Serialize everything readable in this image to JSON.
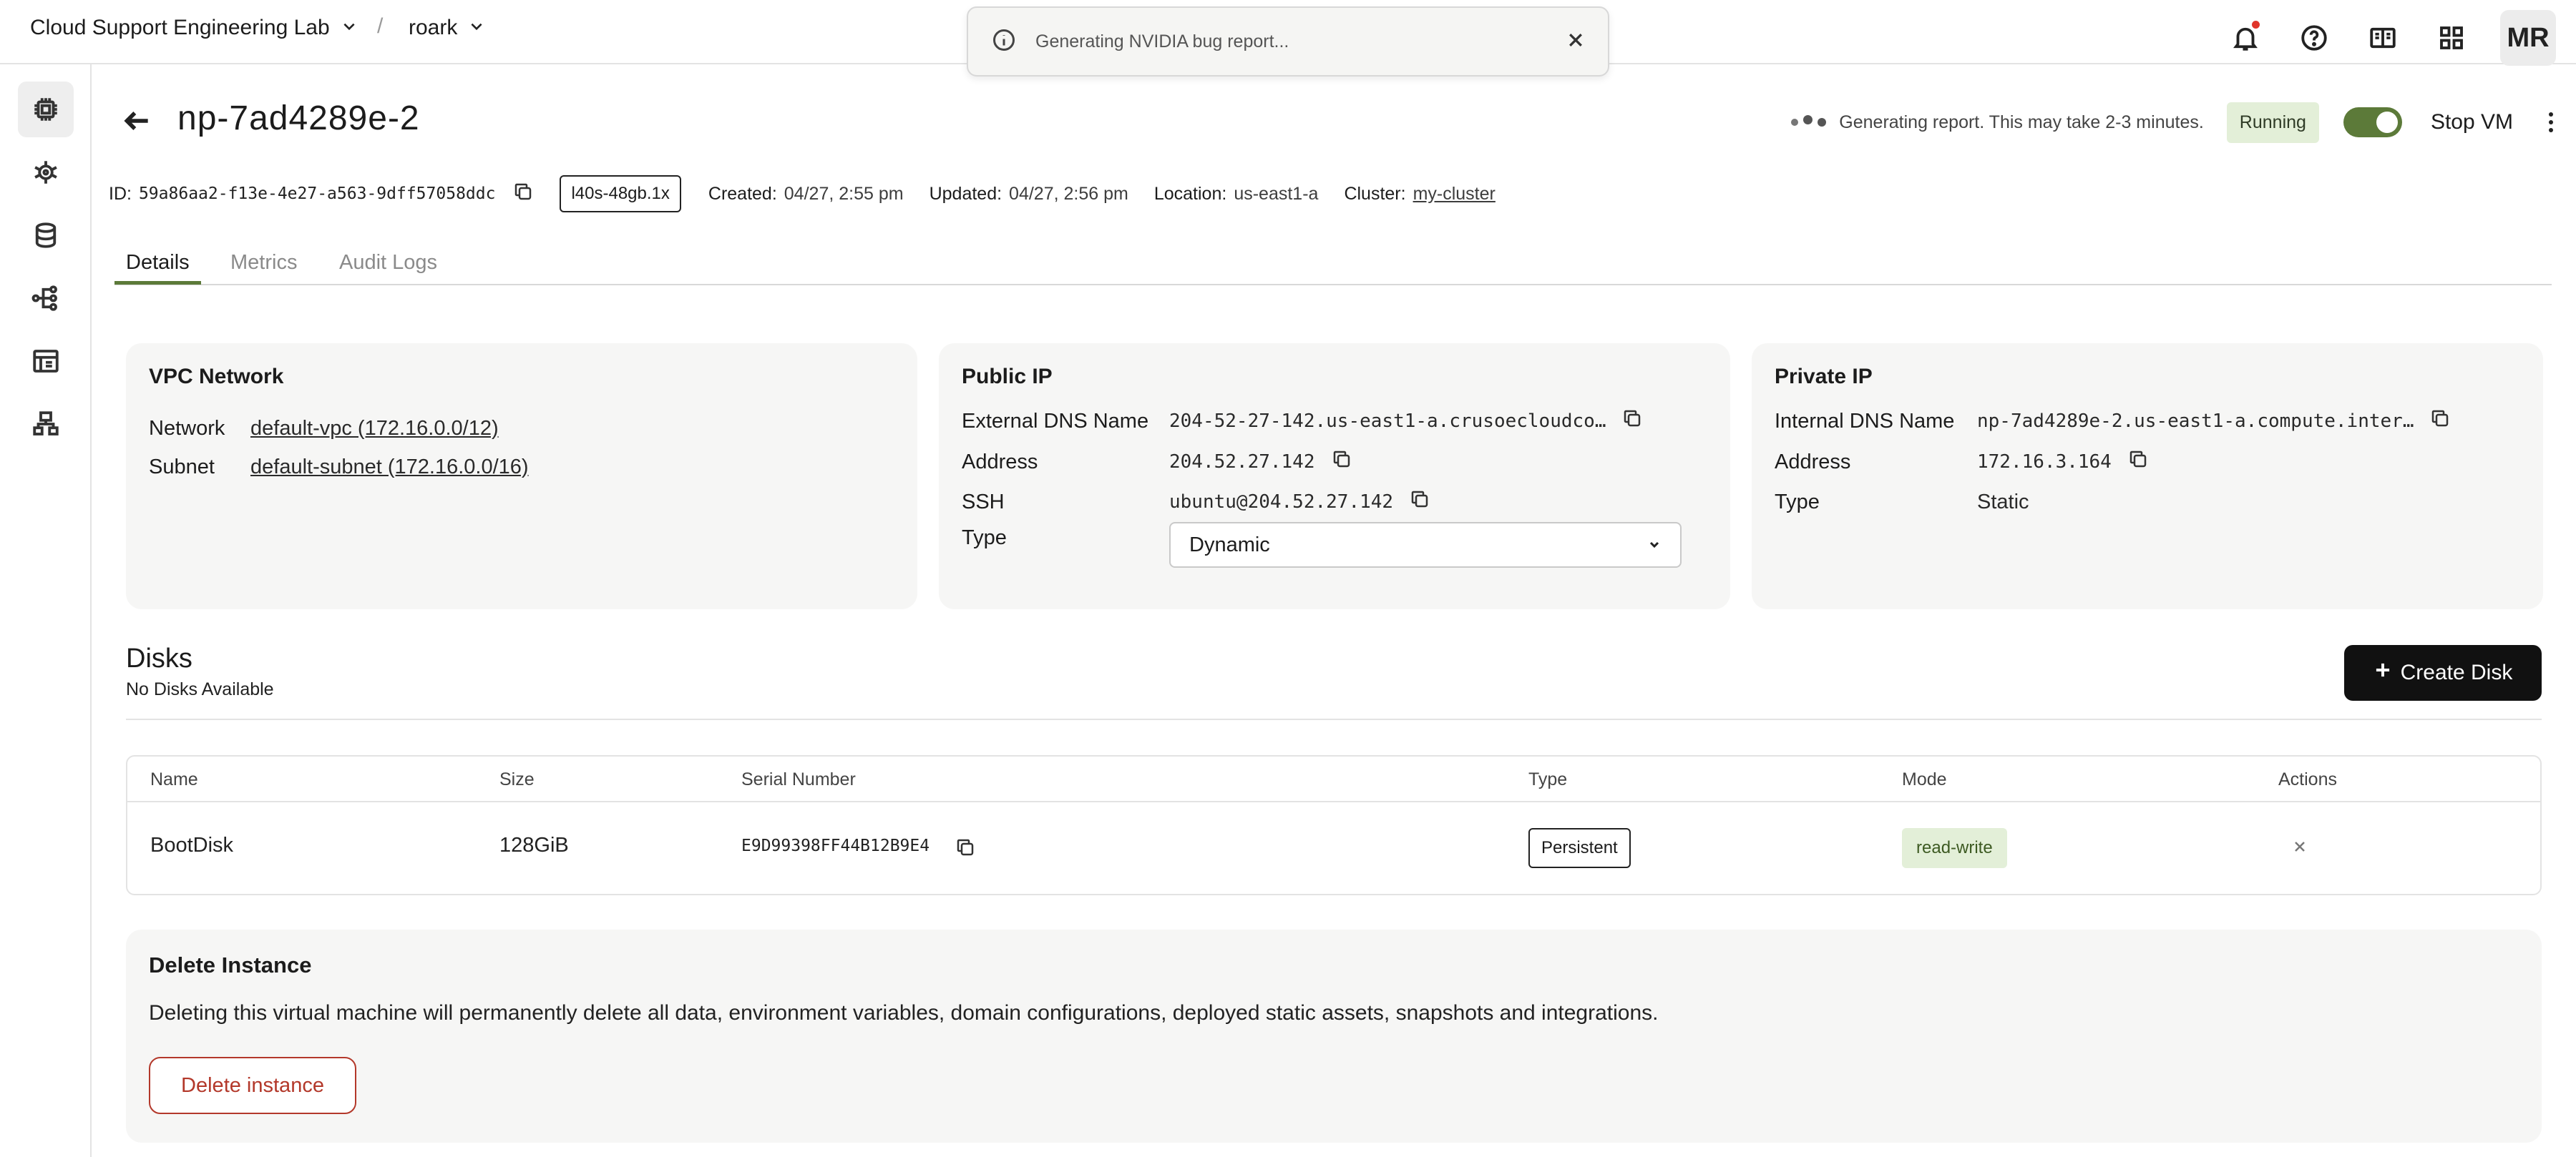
{
  "topbar": {
    "org_name": "Cloud Support Engineering Lab",
    "separator": "/",
    "project_name": "roark",
    "avatar_initials": "MR",
    "icons": [
      "bell-icon",
      "help-icon",
      "docs-icon",
      "apps-grid-icon"
    ]
  },
  "toast": {
    "message": "Generating NVIDIA bug report..."
  },
  "sidebar": {
    "items": [
      "compute-icon",
      "kubernetes-icon",
      "storage-icon",
      "network-icon",
      "billing-icon",
      "org-icon"
    ]
  },
  "header": {
    "title": "np-7ad4289e-2",
    "status_message": "Generating report. This may take 2-3 minutes.",
    "state_badge": "Running",
    "stop_label": "Stop VM"
  },
  "meta": {
    "id_label": "ID:",
    "id_value": "59a86aa2-f13e-4e27-a563-9dff57058ddc",
    "instance_type": "l40s-48gb.1x",
    "created_label": "Created:",
    "created_value": "04/27, 2:55 pm",
    "updated_label": "Updated:",
    "updated_value": "04/27, 2:56 pm",
    "location_label": "Location:",
    "location_value": "us-east1-a",
    "cluster_label": "Cluster:",
    "cluster_value": "my-cluster"
  },
  "tabs": [
    "Details",
    "Metrics",
    "Audit Logs"
  ],
  "vpc": {
    "title": "VPC Network",
    "network_label": "Network",
    "network_value": "default-vpc (172.16.0.0/12)",
    "subnet_label": "Subnet",
    "subnet_value": "default-subnet (172.16.0.0/16)"
  },
  "public_ip": {
    "title": "Public IP",
    "dns_label": "External DNS Name",
    "dns_value": "204-52-27-142.us-east1-a.crusoecloudco…",
    "address_label": "Address",
    "address_value": "204.52.27.142",
    "ssh_label": "SSH",
    "ssh_value": "ubuntu@204.52.27.142",
    "type_label": "Type",
    "type_value": "Dynamic"
  },
  "private_ip": {
    "title": "Private IP",
    "dns_label": "Internal DNS Name",
    "dns_value": "np-7ad4289e-2.us-east1-a.compute.inter…",
    "address_label": "Address",
    "address_value": "172.16.3.164",
    "type_label": "Type",
    "type_value": "Static"
  },
  "disks": {
    "title": "Disks",
    "subtitle": "No Disks Available",
    "create_label": "Create Disk",
    "columns": [
      "Name",
      "Size",
      "Serial Number",
      "Type",
      "Mode",
      "Actions"
    ],
    "rows": [
      {
        "name": "BootDisk",
        "size": "128GiB",
        "serial": "E9D99398FF44B12B9E4",
        "type": "Persistent",
        "mode": "read-write"
      }
    ]
  },
  "delete": {
    "title": "Delete Instance",
    "description": "Deleting this virtual machine will permanently delete all data, environment variables, domain configurations, deployed static assets, snapshots and integrations.",
    "button_label": "Delete instance"
  },
  "colors": {
    "accent": "#5c7a39",
    "danger": "#b3382a",
    "badge_bg": "#e3efd8"
  }
}
